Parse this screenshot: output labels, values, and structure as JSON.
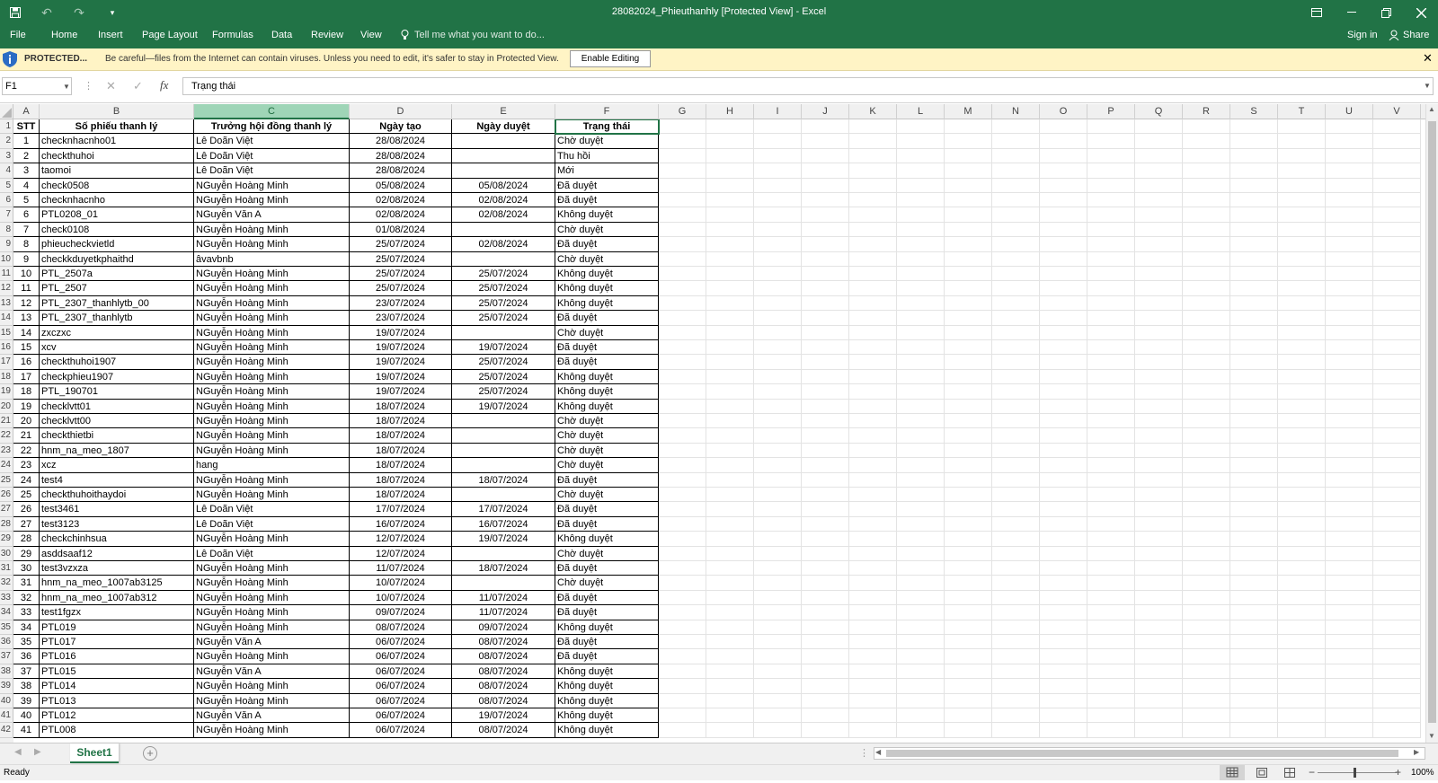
{
  "window": {
    "title": "28082024_Phieuthanhly  [Protected View] - Excel"
  },
  "ribbon": {
    "tabs": [
      "File",
      "Home",
      "Insert",
      "Page Layout",
      "Formulas",
      "Data",
      "Review",
      "View"
    ],
    "tell_me": "Tell me what you want to do...",
    "sign_in": "Sign in",
    "share": "Share"
  },
  "protected_bar": {
    "label": "PROTECTED...",
    "message": "Be careful—files from the Internet can contain viruses. Unless you need to edit, it's safer to stay in Protected View.",
    "enable_button": "Enable Editing"
  },
  "formula_bar": {
    "name_box": "F1",
    "fx": "fx",
    "content": "Trạng thái"
  },
  "columns": [
    "A",
    "B",
    "C",
    "D",
    "E",
    "F",
    "G",
    "H",
    "I",
    "J",
    "K",
    "L",
    "M",
    "N",
    "O",
    "P",
    "Q",
    "R",
    "S",
    "T",
    "U",
    "V"
  ],
  "selected_column": "C",
  "active_cell": "F1",
  "row_numbers": [
    "1",
    "2",
    "3",
    "4",
    "5",
    "6",
    "7",
    "8",
    "9",
    "10",
    "11",
    "12",
    "13",
    "14",
    "15",
    "16",
    "17",
    "18",
    "19",
    "20",
    "21",
    "22",
    "23",
    "24",
    "25",
    "26",
    "27",
    "28",
    "29",
    "30",
    "31",
    "32",
    "33",
    "34",
    "35",
    "36",
    "37",
    "38",
    "39",
    "40",
    "41",
    "42"
  ],
  "headers": [
    "STT",
    "Số phiếu thanh lý",
    "Trưởng hội đồng thanh lý",
    "Ngày tạo",
    "Ngày duyệt",
    "Trạng thái"
  ],
  "rows": [
    [
      "1",
      "checknhacnho01",
      "Lê Doãn Việt",
      "28/08/2024",
      "",
      "Chờ duyệt"
    ],
    [
      "2",
      "checkthuhoi",
      "Lê Doãn Việt",
      "28/08/2024",
      "",
      "Thu hồi"
    ],
    [
      "3",
      "taomoi",
      "Lê Doãn Việt",
      "28/08/2024",
      "",
      "Mới"
    ],
    [
      "4",
      "check0508",
      "NGuyễn Hoàng Minh",
      "05/08/2024",
      "05/08/2024",
      "Đã duyệt"
    ],
    [
      "5",
      "checknhacnho",
      "NGuyễn Hoàng Minh",
      "02/08/2024",
      "02/08/2024",
      "Đã duyệt"
    ],
    [
      "6",
      "PTL0208_01",
      "NGuyễn Văn A",
      "02/08/2024",
      "02/08/2024",
      "Không duyệt"
    ],
    [
      "7",
      "check0108",
      "NGuyễn Hoàng Minh",
      "01/08/2024",
      "",
      "Chờ duyệt"
    ],
    [
      "8",
      "phieucheckvietld",
      "NGuyễn Hoàng Minh",
      "25/07/2024",
      "02/08/2024",
      "Đã duyệt"
    ],
    [
      "9",
      "checkkduyetkphaithd",
      "âvavbnb",
      "25/07/2024",
      "",
      "Chờ duyệt"
    ],
    [
      "10",
      "PTL_2507a",
      "NGuyễn Hoàng Minh",
      "25/07/2024",
      "25/07/2024",
      "Không duyệt"
    ],
    [
      "11",
      "PTL_2507",
      "NGuyễn Hoàng Minh",
      "25/07/2024",
      "25/07/2024",
      "Không duyệt"
    ],
    [
      "12",
      "PTL_2307_thanhlytb_00",
      "NGuyễn Hoàng Minh",
      "23/07/2024",
      "25/07/2024",
      "Không duyệt"
    ],
    [
      "13",
      "PTL_2307_thanhlytb",
      "NGuyễn Hoàng Minh",
      "23/07/2024",
      "25/07/2024",
      "Đã duyệt"
    ],
    [
      "14",
      "zxczxc",
      "NGuyễn Hoàng Minh",
      "19/07/2024",
      "",
      "Chờ duyệt"
    ],
    [
      "15",
      "xcv",
      "NGuyễn Hoàng Minh",
      "19/07/2024",
      "19/07/2024",
      "Đã duyệt"
    ],
    [
      "16",
      "checkthuhoi1907",
      "NGuyễn Hoàng Minh",
      "19/07/2024",
      "25/07/2024",
      "Đã duyệt"
    ],
    [
      "17",
      "checkphieu1907",
      "NGuyễn Hoàng Minh",
      "19/07/2024",
      "25/07/2024",
      "Không duyệt"
    ],
    [
      "18",
      "PTL_190701",
      "NGuyễn Hoàng Minh",
      "19/07/2024",
      "25/07/2024",
      "Không duyệt"
    ],
    [
      "19",
      "checklvtt01",
      "NGuyễn Hoàng Minh",
      "18/07/2024",
      "19/07/2024",
      "Không duyệt"
    ],
    [
      "20",
      "checklvtt00",
      "NGuyễn Hoàng Minh",
      "18/07/2024",
      "",
      "Chờ duyệt"
    ],
    [
      "21",
      "checkthietbi",
      "NGuyễn Hoàng Minh",
      "18/07/2024",
      "",
      "Chờ duyệt"
    ],
    [
      "22",
      "hnm_na_meo_1807",
      "NGuyễn Hoàng Minh",
      "18/07/2024",
      "",
      "Chờ duyệt"
    ],
    [
      "23",
      "xcz",
      "hang",
      "18/07/2024",
      "",
      "Chờ duyệt"
    ],
    [
      "24",
      "test4",
      "NGuyễn Hoàng Minh",
      "18/07/2024",
      "18/07/2024",
      "Đã duyệt"
    ],
    [
      "25",
      "checkthuhoithaydoi",
      "NGuyễn Hoàng Minh",
      "18/07/2024",
      "",
      "Chờ duyệt"
    ],
    [
      "26",
      "test3461",
      "Lê Doãn Việt",
      "17/07/2024",
      "17/07/2024",
      "Đã duyệt"
    ],
    [
      "27",
      "test3123",
      "Lê Doãn Việt",
      "16/07/2024",
      "16/07/2024",
      "Đã duyệt"
    ],
    [
      "28",
      "checkchinhsua",
      "NGuyễn Hoàng Minh",
      "12/07/2024",
      "19/07/2024",
      "Không duyệt"
    ],
    [
      "29",
      "asddsaaf12",
      "Lê Doãn Việt",
      "12/07/2024",
      "",
      "Chờ duyệt"
    ],
    [
      "30",
      "test3vzxza",
      "NGuyễn Hoàng Minh",
      "11/07/2024",
      "18/07/2024",
      "Đã duyệt"
    ],
    [
      "31",
      "hnm_na_meo_1007ab3125",
      "NGuyễn Hoàng Minh",
      "10/07/2024",
      "",
      "Chờ duyệt"
    ],
    [
      "32",
      "hnm_na_meo_1007ab312",
      "NGuyễn Hoàng Minh",
      "10/07/2024",
      "11/07/2024",
      "Đã duyệt"
    ],
    [
      "33",
      "test1fgzx",
      "NGuyễn Hoàng Minh",
      "09/07/2024",
      "11/07/2024",
      "Đã duyệt"
    ],
    [
      "34",
      "PTL019",
      "NGuyễn Hoàng Minh",
      "08/07/2024",
      "09/07/2024",
      "Không duyệt"
    ],
    [
      "35",
      "PTL017",
      "NGuyễn Văn A",
      "06/07/2024",
      "08/07/2024",
      "Đã duyệt"
    ],
    [
      "36",
      "PTL016",
      "NGuyễn Hoàng Minh",
      "06/07/2024",
      "08/07/2024",
      "Đã duyệt"
    ],
    [
      "37",
      "PTL015",
      "NGuyễn Văn A",
      "06/07/2024",
      "08/07/2024",
      "Không duyệt"
    ],
    [
      "38",
      "PTL014",
      "NGuyễn Hoàng Minh",
      "06/07/2024",
      "08/07/2024",
      "Không duyệt"
    ],
    [
      "39",
      "PTL013",
      "NGuyễn Hoàng Minh",
      "06/07/2024",
      "08/07/2024",
      "Không duyệt"
    ],
    [
      "40",
      "PTL012",
      "NGuyễn Văn A",
      "06/07/2024",
      "19/07/2024",
      "Không duyệt"
    ],
    [
      "41",
      "PTL008",
      "NGuyễn Hoàng Minh",
      "06/07/2024",
      "08/07/2024",
      "Không duyệt"
    ]
  ],
  "sheet_tabs": [
    "Sheet1"
  ],
  "status": {
    "ready": "Ready",
    "zoom": "100%"
  },
  "colors": {
    "excel_green": "#217346",
    "protected_bg": "#fff4c5",
    "selected_header": "#9fd5b7"
  }
}
